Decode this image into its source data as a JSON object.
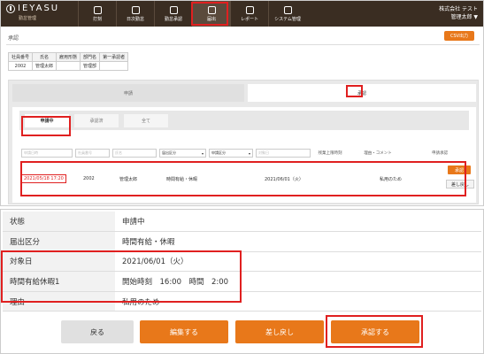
{
  "header": {
    "logo": "IEYASU",
    "logo_sub": "勤怠管理",
    "nav": [
      {
        "label": "打刻",
        "icon": "clock-icon"
      },
      {
        "label": "日次勤怠",
        "icon": "calendar-icon"
      },
      {
        "label": "勤怠承認",
        "icon": "document-icon"
      },
      {
        "label": "届出",
        "icon": "file-icon"
      },
      {
        "label": "レポート",
        "icon": "report-icon"
      },
      {
        "label": "システム管理",
        "icon": "monitor-icon"
      }
    ],
    "company": "株式会社 テスト",
    "user": "管理太郎 ▼"
  },
  "page": {
    "title": "承認",
    "csv_label": "CSV出力"
  },
  "employee_table": {
    "headers": [
      "社員番号",
      "氏名",
      "雇用形態",
      "部門名",
      "第一承認者"
    ],
    "row": [
      "2002",
      "管理太郎",
      "",
      "管理部",
      ""
    ]
  },
  "tabs": {
    "apply": "申請",
    "approve": "承認"
  },
  "subtabs": [
    "申請中",
    "承認済",
    "全て"
  ],
  "filters": {
    "date_placeholder": "申請日時",
    "empno_placeholder": "社員番号",
    "name_placeholder": "氏名",
    "type_select": "届出区分",
    "status_select": "申請区分",
    "target_placeholder": "対象日",
    "over_header": "残業上限時刻",
    "reason_header": "理由・コメント",
    "approve_header": "申請承認"
  },
  "request_row": {
    "datetime": "2021/05/18 17:20",
    "empno": "2002",
    "name": "管理太郎",
    "type": "時間有給・休暇",
    "target": "2021/06/01（火）",
    "reason": "私用のため",
    "approve_btn": "承認",
    "return_btn": "差し戻し"
  },
  "detail": [
    {
      "key": "状態",
      "value": "申請中"
    },
    {
      "key": "届出区分",
      "value": "時間有給・休暇"
    },
    {
      "key": "対象日",
      "value": "2021/06/01（火）"
    },
    {
      "key": "時間有給休暇1",
      "value": "開始時刻　16:00　時間　2:00"
    },
    {
      "key": "理由",
      "value": "私用のため"
    }
  ],
  "actions": {
    "back": "戻る",
    "edit": "編集する",
    "return": "差し戻し",
    "approve": "承認する"
  },
  "colors": {
    "header_bg": "#3a2d22",
    "accent": "#e8781a",
    "highlight": "#e02020"
  }
}
